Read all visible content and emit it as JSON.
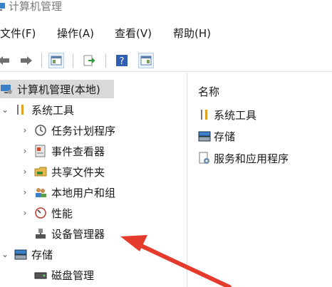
{
  "window": {
    "title": "计算机管理"
  },
  "menu": {
    "file": "文件(F)",
    "action": "操作(A)",
    "view": "查看(V)",
    "help": "帮助(H)"
  },
  "toolbar": {
    "items": [
      "back-arrow-icon",
      "forward-arrow-icon",
      "show-hide-tree-icon",
      "export-list-icon",
      "help-icon",
      "properties-icon"
    ]
  },
  "tree": {
    "root": "计算机管理(本地)",
    "system_tools": "系统工具",
    "task_scheduler": "任务计划程序",
    "event_viewer": "事件查看器",
    "shared_folders": "共享文件夹",
    "local_users": "本地用户和组",
    "performance": "性能",
    "device_manager": "设备管理器",
    "storage": "存储",
    "disk_management": "磁盘管理"
  },
  "right_pane": {
    "column_header": "名称",
    "items": [
      "系统工具",
      "存储",
      "服务和应用程序"
    ]
  },
  "colors": {
    "annotation_arrow": "#e53b2c",
    "selection": "#d9d9d9"
  }
}
